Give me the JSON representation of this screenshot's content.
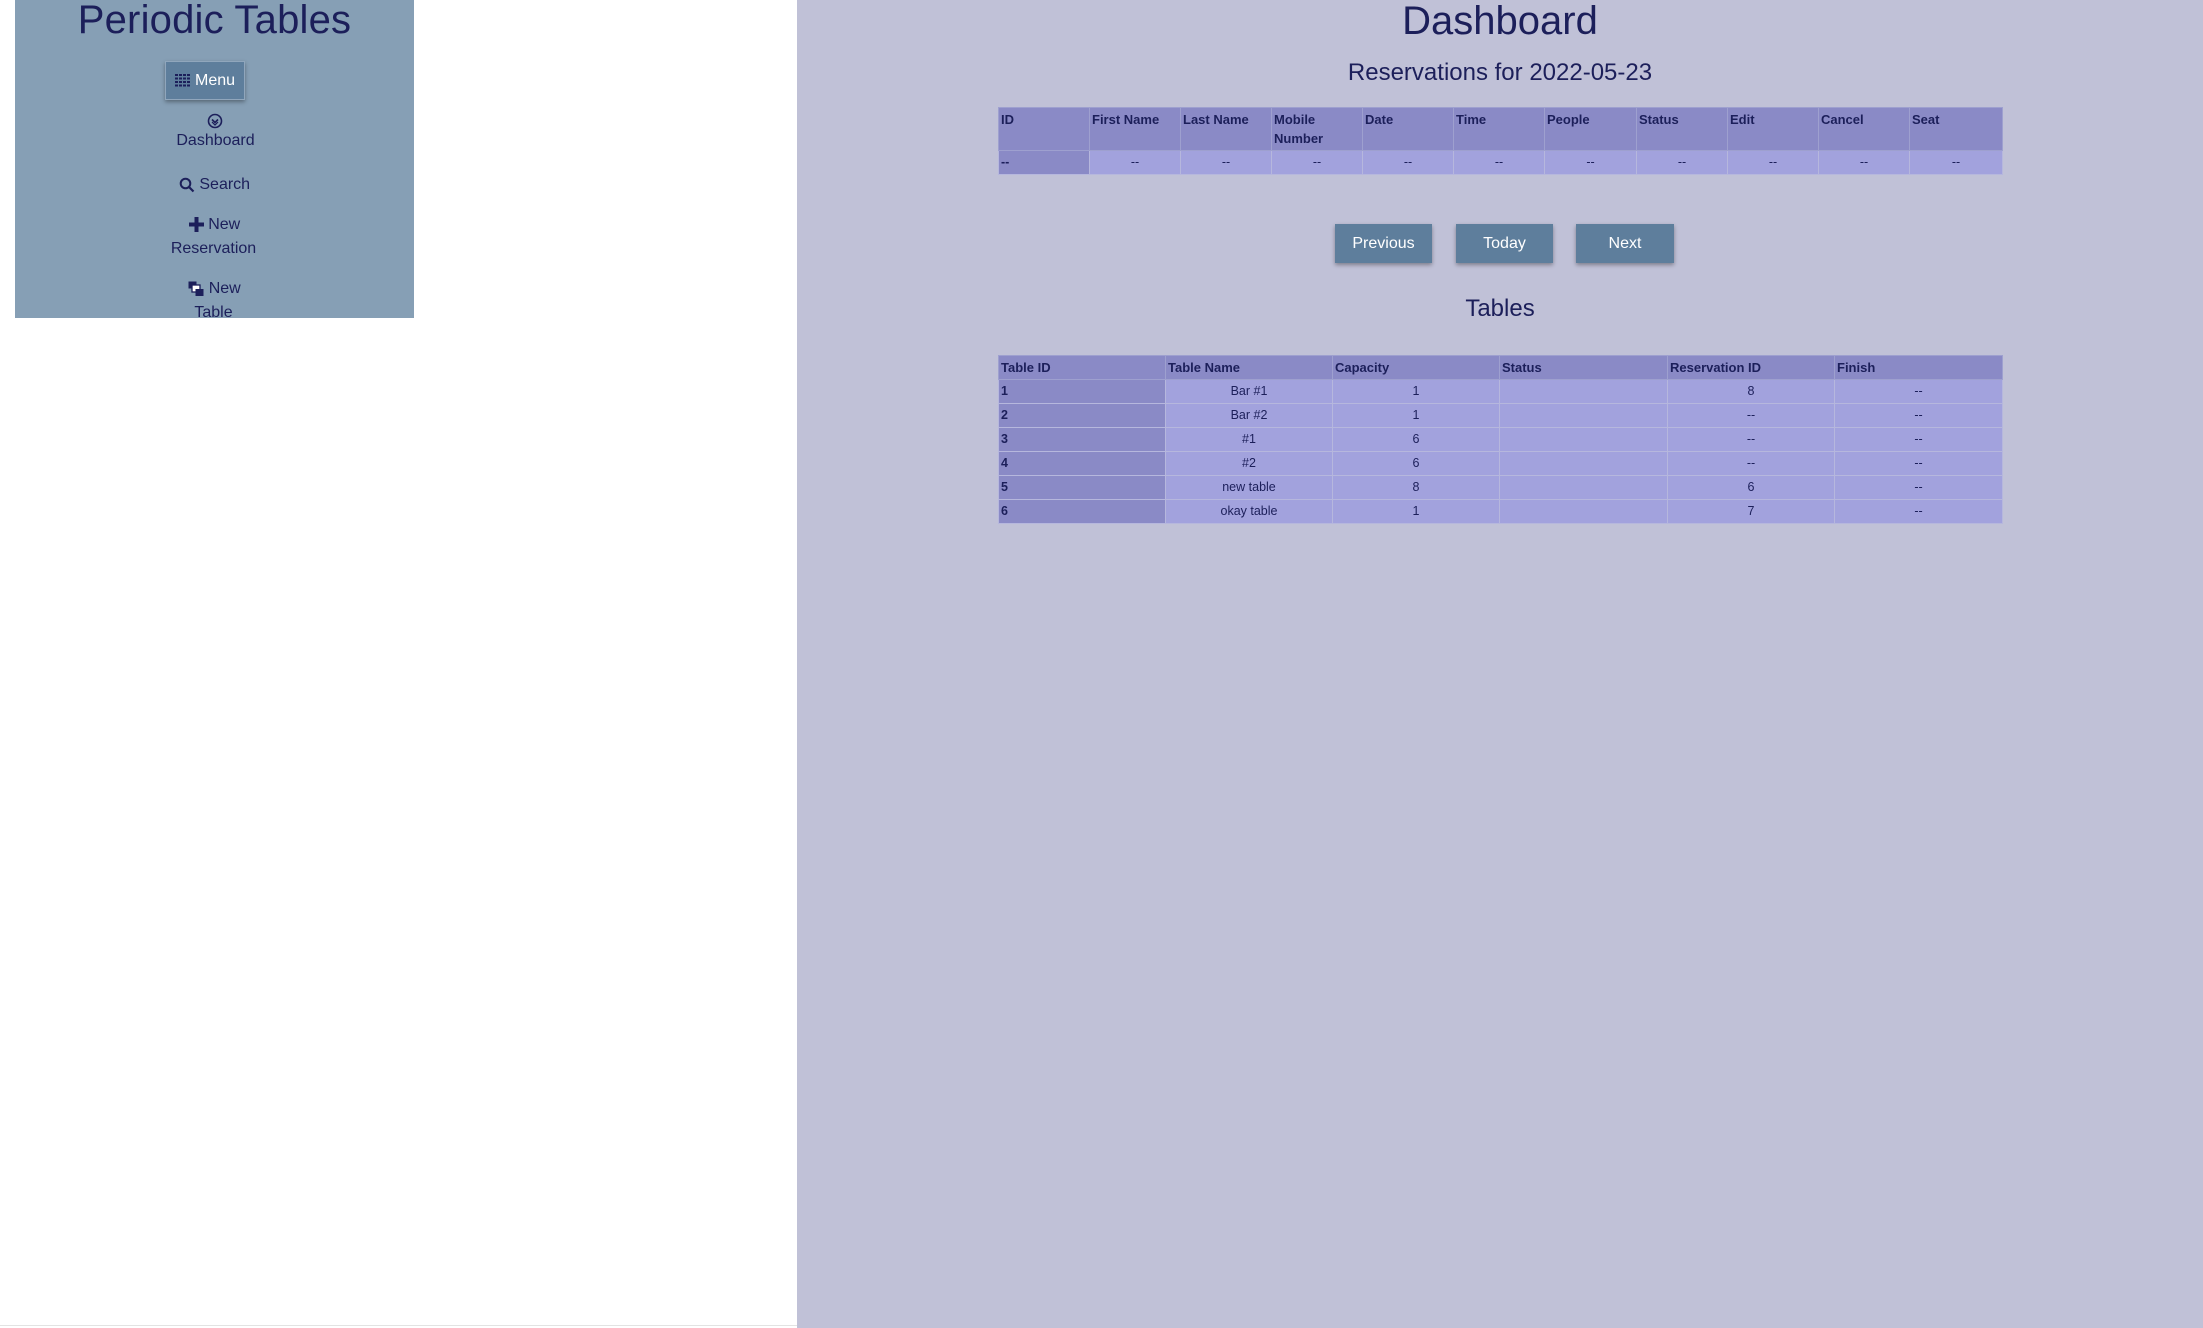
{
  "sidebar": {
    "brand": "Periodic Tables",
    "menu_label": "Menu",
    "items": [
      {
        "label": "Dashboard",
        "icon": "dashboard-icon"
      },
      {
        "label": "Search",
        "icon": "search-icon"
      },
      {
        "label_line1": "New",
        "label_line2": "Reservation",
        "icon": "plus-icon"
      },
      {
        "label_line1": "New",
        "label_line2": "Table",
        "icon": "tables-icon"
      }
    ]
  },
  "main": {
    "title": "Dashboard",
    "reservations_heading": "Reservations for 2022-05-23",
    "tables_heading": "Tables",
    "buttons": {
      "previous": "Previous",
      "today": "Today",
      "next": "Next"
    }
  },
  "reservations": {
    "headers": [
      "ID",
      "First Name",
      "Last Name",
      "Mobile Number",
      "Date",
      "Time",
      "People",
      "Status",
      "Edit",
      "Cancel",
      "Seat"
    ],
    "rows": [
      [
        "--",
        "--",
        "--",
        "--",
        "--",
        "--",
        "--",
        "--",
        "--",
        "--",
        "--"
      ]
    ]
  },
  "tables": {
    "headers": [
      "Table ID",
      "Table Name",
      "Capacity",
      "Status",
      "Reservation ID",
      "Finish"
    ],
    "rows": [
      [
        "1",
        "Bar #1",
        "1",
        "",
        "8",
        "--"
      ],
      [
        "2",
        "Bar #2",
        "1",
        "",
        "--",
        "--"
      ],
      [
        "3",
        "#1",
        "6",
        "",
        "--",
        "--"
      ],
      [
        "4",
        "#2",
        "6",
        "",
        "--",
        "--"
      ],
      [
        "5",
        "new table",
        "8",
        "",
        "6",
        "--"
      ],
      [
        "6",
        "okay table",
        "1",
        "",
        "7",
        "--"
      ]
    ]
  },
  "colors": {
    "sidebar_bg": "#869fb5",
    "main_bg": "#c0c1d7",
    "button_bg": "#5e7e9c",
    "header_cell": "#8a8ac6",
    "body_cell": "#a2a2dd",
    "text": "#1c1f5a"
  }
}
